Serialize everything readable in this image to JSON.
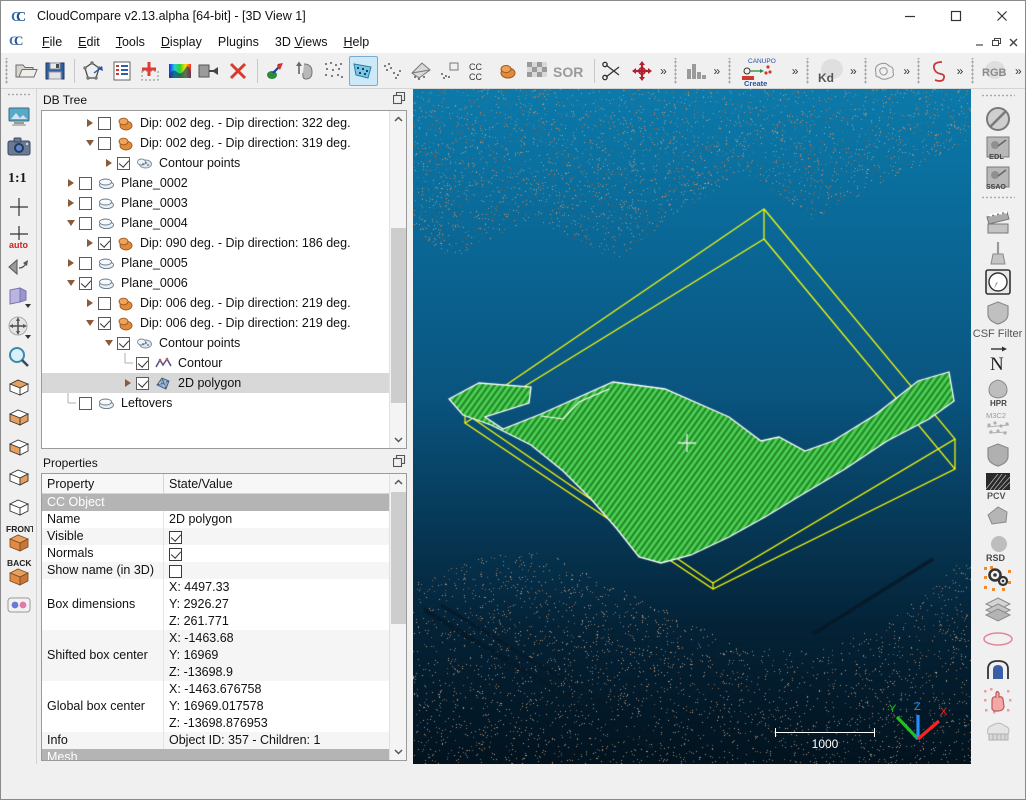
{
  "window": {
    "title": "CloudCompare v2.13.alpha [64-bit] - [3D View 1]",
    "minimize": "—",
    "maximize": "□",
    "close": "✕"
  },
  "mdi_buttons": {
    "minimize": "_",
    "restore": "❐",
    "close": "✕"
  },
  "menu": [
    {
      "name": "menu-file",
      "label": "File",
      "mnemonic": "F"
    },
    {
      "name": "menu-edit",
      "label": "Edit",
      "mnemonic": "E"
    },
    {
      "name": "menu-tools",
      "label": "Tools",
      "mnemonic": "T"
    },
    {
      "name": "menu-display",
      "label": "Display",
      "mnemonic": "D"
    },
    {
      "name": "menu-plugins",
      "label": "Plugins",
      "mnemonic": "P"
    },
    {
      "name": "menu-3dviews",
      "label": "3D Views",
      "mnemonic": "V"
    },
    {
      "name": "menu-help",
      "label": "Help",
      "mnemonic": "H"
    }
  ],
  "toolbar": {
    "overflow_symbol": "»",
    "items": [
      {
        "name": "open-icon",
        "tip": "Open"
      },
      {
        "name": "save-icon",
        "tip": "Save"
      },
      {
        "name": "sep"
      },
      {
        "name": "global-shift-icon",
        "tip": "Global shift settings"
      },
      {
        "name": "properties-list-icon",
        "tip": "Toggle properties"
      },
      {
        "name": "add-point-icon",
        "tip": "Point picking"
      },
      {
        "name": "colorscale-icon",
        "tip": "Color scales manager"
      },
      {
        "name": "crop-icon",
        "tip": "Crop"
      },
      {
        "name": "delete-icon",
        "tip": "Delete"
      },
      {
        "name": "sep"
      },
      {
        "name": "compute-normals-icon",
        "tip": "Compute normals"
      },
      {
        "name": "invert-normals-icon",
        "tip": "Invert normals"
      },
      {
        "name": "subsample-icon",
        "tip": "Subsample"
      },
      {
        "name": "segment-icon",
        "tip": "Segment",
        "selected": true
      },
      {
        "name": "cloud-cloud-dist-icon",
        "tip": "Cloud/Cloud distance"
      },
      {
        "name": "cloud-mesh-dist-icon",
        "tip": "Cloud/Mesh distance"
      },
      {
        "name": "cloud-prim-dist-icon",
        "tip": "Cloud/Primitive distance"
      },
      {
        "name": "cc-register-icon",
        "tip": "Register"
      },
      {
        "name": "fit-plane-icon",
        "tip": "Fit plane"
      },
      {
        "name": "noise-filter-icon",
        "tip": "Noise filter"
      },
      {
        "name": "sor-filter-icon",
        "tip": "SOR filter"
      },
      {
        "name": "sep"
      },
      {
        "name": "scissors-icon",
        "tip": "Cut"
      },
      {
        "name": "translate-rotate-icon",
        "tip": "Translate/Rotate"
      },
      {
        "name": "more"
      },
      {
        "name": "sep"
      },
      {
        "name": "histogram-icon",
        "tip": "Histogram"
      },
      {
        "name": "more"
      },
      {
        "name": "sep"
      },
      {
        "name": "canupo-create-icon",
        "tip": "CANUPO Create",
        "label_top": "CANUPO",
        "label_bot": "Create"
      },
      {
        "name": "more"
      },
      {
        "name": "sep"
      },
      {
        "name": "kd-tree-icon",
        "tip": "Kd-tree",
        "label": "Kd"
      },
      {
        "name": "more"
      },
      {
        "name": "sep"
      },
      {
        "name": "contour-plugin-icon",
        "tip": "Contour plugin"
      },
      {
        "name": "more"
      },
      {
        "name": "sep"
      },
      {
        "name": "surface-ratio-icon",
        "tip": "Surface ratio"
      },
      {
        "name": "more"
      },
      {
        "name": "sep"
      },
      {
        "name": "rgb-convert-icon",
        "tip": "RGB convert",
        "label": "RGB"
      },
      {
        "name": "more"
      }
    ]
  },
  "left_toolbar": [
    {
      "name": "zoom-global-icon",
      "tip": "Zoom & center on selected entities"
    },
    {
      "name": "camera-snapshot-icon",
      "tip": "Render to file"
    },
    {
      "name": "zoom-1to1-icon",
      "tip": "Set pixel size to 1",
      "label": "1:1"
    },
    {
      "name": "set-pivot-icon",
      "tip": "Set pivot point"
    },
    {
      "name": "auto-pivot-icon",
      "tip": "Auto pivot",
      "label": "auto"
    },
    {
      "name": "camera-persp-icon",
      "tip": "Object-centered perspective"
    },
    {
      "name": "view-mode-icon",
      "tip": "View mode"
    },
    {
      "name": "translate-view-icon",
      "tip": "Translate / rotate"
    },
    {
      "name": "zoom-box-icon",
      "tip": "Zoom box"
    },
    {
      "name": "view-top-icon",
      "tip": "Top view"
    },
    {
      "name": "view-bottom-icon",
      "tip": "Bottom view"
    },
    {
      "name": "view-left-icon",
      "tip": "Left view"
    },
    {
      "name": "view-right-icon",
      "tip": "Right view"
    },
    {
      "name": "view-iso1-icon",
      "tip": "Isometric view 1"
    },
    {
      "name": "view-front-icon",
      "tip": "Front view",
      "label": "FRONT"
    },
    {
      "name": "view-back-icon",
      "tip": "Back view",
      "label": "BACK"
    },
    {
      "name": "stereo-mode-icon",
      "tip": "Stereo mode"
    }
  ],
  "right_toolbar": [
    {
      "name": "no-shader-icon",
      "tip": "No shader"
    },
    {
      "name": "edl-shader-icon",
      "tip": "EDL shader",
      "label": "EDL"
    },
    {
      "name": "ssao-shader-icon",
      "tip": "SSAO shader",
      "label": "SSAO"
    },
    {
      "name": "grip"
    },
    {
      "name": "animation-icon",
      "tip": "Animation plugin"
    },
    {
      "name": "broom-icon",
      "tip": "Clean plugin"
    },
    {
      "name": "compass-icon",
      "tip": "Compass plugin"
    },
    {
      "name": "csf-filter-icon",
      "tip": "CSF filter"
    },
    {
      "name": "csf-filter-label",
      "label": "CSF Filter",
      "static": true
    },
    {
      "name": "normals-n-icon",
      "tip": "Normals",
      "label": "N"
    },
    {
      "name": "hpr-icon",
      "tip": "Hidden point removal",
      "label": "HPR"
    },
    {
      "name": "m3c2-icon",
      "tip": "M3C2 distance",
      "label": "M3C2"
    },
    {
      "name": "masonry-icon",
      "tip": "Masonry segmentation"
    },
    {
      "name": "pcv-icon",
      "tip": "PCV / ShadeVis",
      "label": "PCV"
    },
    {
      "name": "poisson-icon",
      "tip": "Poisson surface reconstruction"
    },
    {
      "name": "rsd-icon",
      "tip": "RANSAC shape detection",
      "label": "RSD"
    },
    {
      "name": "cork-gears-icon",
      "tip": "Mesh boolean operations"
    },
    {
      "name": "layers-icon",
      "tip": "qCSF / layers"
    },
    {
      "name": "ellipse-icon",
      "tip": "Fit ellipse"
    },
    {
      "name": "tunnel-icon",
      "tip": "Section extraction"
    },
    {
      "name": "hough-normals-icon",
      "tip": "Hough normals"
    },
    {
      "name": "treeiso-icon",
      "tip": "Tree ISO"
    }
  ],
  "db_tree": {
    "title": "DB Tree",
    "float_button": "float-icon",
    "items": [
      {
        "depth": 2,
        "twist": "right",
        "checked": false,
        "icon": "facet-icon",
        "label": "Dip: 002 deg. - Dip direction: 322 deg."
      },
      {
        "depth": 2,
        "twist": "down",
        "checked": false,
        "icon": "facet-icon",
        "label": "Dip: 002 deg. - Dip direction: 319 deg."
      },
      {
        "depth": 3,
        "twist": "right",
        "checked": true,
        "icon": "cloud-icon",
        "label": "Contour points"
      },
      {
        "depth": 1,
        "twist": "right",
        "checked": false,
        "icon": "plane-icon",
        "label": "Plane_0002"
      },
      {
        "depth": 1,
        "twist": "right",
        "checked": false,
        "icon": "plane-icon",
        "label": "Plane_0003"
      },
      {
        "depth": 1,
        "twist": "down",
        "checked": false,
        "icon": "plane-icon",
        "label": "Plane_0004"
      },
      {
        "depth": 2,
        "twist": "right",
        "checked": true,
        "icon": "facet-icon",
        "label": "Dip: 090 deg. - Dip direction: 186 deg."
      },
      {
        "depth": 1,
        "twist": "right",
        "checked": false,
        "icon": "plane-icon",
        "label": "Plane_0005"
      },
      {
        "depth": 1,
        "twist": "down",
        "checked": true,
        "icon": "plane-icon",
        "label": "Plane_0006"
      },
      {
        "depth": 2,
        "twist": "right",
        "checked": false,
        "icon": "facet-icon",
        "label": "Dip: 006 deg. - Dip direction: 219 deg."
      },
      {
        "depth": 2,
        "twist": "down",
        "checked": true,
        "icon": "facet-icon",
        "label": "Dip: 006 deg. - Dip direction: 219 deg."
      },
      {
        "depth": 3,
        "twist": "down",
        "checked": true,
        "icon": "cloud-icon",
        "label": "Contour points"
      },
      {
        "depth": 4,
        "twist": "none",
        "checked": true,
        "icon": "polyline-icon",
        "label": "Contour"
      },
      {
        "depth": 4,
        "twist": "right",
        "checked": true,
        "icon": "mesh-icon",
        "label": "2D polygon",
        "selected": true
      },
      {
        "depth": 1,
        "twist": "none",
        "checked": false,
        "icon": "plane-icon",
        "label": "Leftovers"
      }
    ]
  },
  "properties": {
    "title": "Properties",
    "float_button": "float-icon",
    "headers": {
      "property": "Property",
      "value": "State/Value"
    },
    "rows": [
      {
        "type": "section",
        "label": "CC Object"
      },
      {
        "type": "text",
        "key": "Name",
        "value": "2D polygon"
      },
      {
        "type": "checkbox",
        "key": "Visible",
        "checked": true
      },
      {
        "type": "checkbox",
        "key": "Normals",
        "checked": true
      },
      {
        "type": "checkbox",
        "key": "Show name (in 3D)",
        "checked": false
      },
      {
        "type": "multi",
        "key": "Box dimensions",
        "values": [
          "X: 4497.33",
          "Y: 2926.27",
          "Z: 261.771"
        ]
      },
      {
        "type": "multi",
        "key": "Shifted box center",
        "values": [
          "X: -1463.68",
          "Y: 16969",
          "Z: -13698.9"
        ]
      },
      {
        "type": "multi",
        "key": "Global box center",
        "values": [
          "X: -1463.676758",
          "Y: 16969.017578",
          "Z: -13698.876953"
        ]
      },
      {
        "type": "text",
        "key": "Info",
        "value": "Object ID: 357 - Children: 1"
      },
      {
        "type": "section",
        "label": "Mesh"
      }
    ]
  },
  "view3d": {
    "scale_bar_label": "1000",
    "axis_labels": {
      "x": "X",
      "y": "Y",
      "z": "Z"
    },
    "colors": {
      "background_top": "#0a76a8",
      "background_bottom": "#031a2b",
      "point_cloud": "#a8876e",
      "mesh_green": "#36b33a",
      "polygon_yellow": "#ffff00",
      "contour_white": "#ffffff",
      "axis_x": "#ff2020",
      "axis_y": "#20c020",
      "axis_z": "#2090ff"
    }
  }
}
